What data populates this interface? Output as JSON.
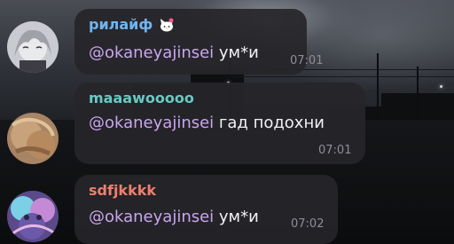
{
  "colors": {
    "bubble": "#262529",
    "mention": "#c9a6ee",
    "text": "#f2f2f4",
    "time": "#8f8d96"
  },
  "messages": [
    {
      "sender": "рилайф",
      "sender_color": "#6fb6f2",
      "has_badge": true,
      "badge_icon": "hello-kitty-icon",
      "mention": "@okaneyajinsei",
      "text": " ум*и",
      "time": "07:01"
    },
    {
      "sender": "maaawooooo",
      "sender_color": "#67c9c2",
      "has_badge": false,
      "mention": "@okaneyajinsei",
      "text": " гад подохни",
      "time": "07:01"
    },
    {
      "sender": "sdfjkkkk",
      "sender_color": "#ef7f6f",
      "has_badge": false,
      "mention": "@okaneyajinsei",
      "text": " ум*и",
      "time": "07:02"
    }
  ]
}
